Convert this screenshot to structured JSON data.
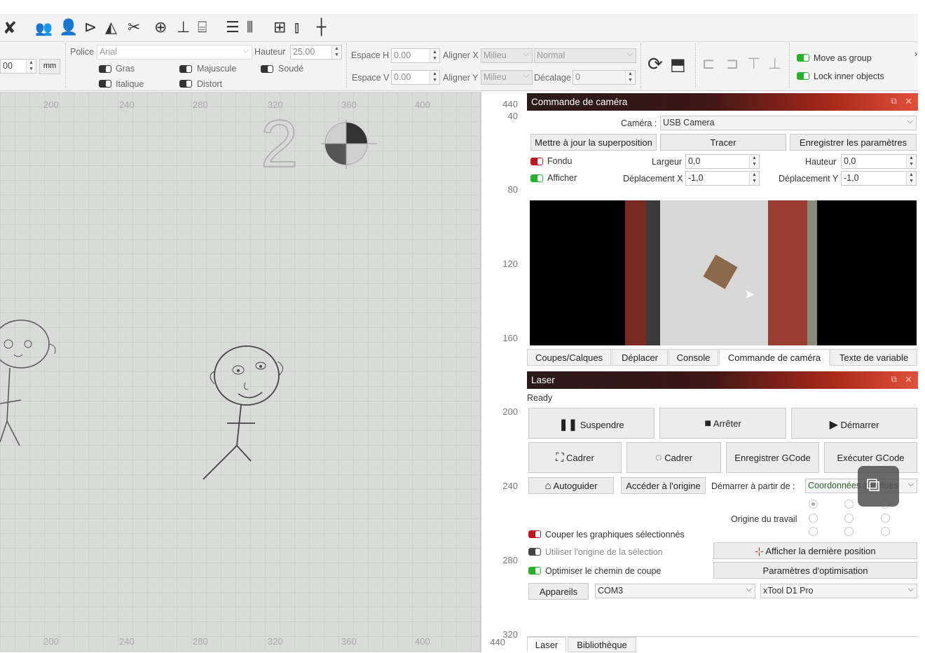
{
  "toolbar": {
    "icons": [
      "wrench-icon",
      "users-icon",
      "user-icon",
      "triangle-flag-icon",
      "mirror-icon",
      "scissors-icon",
      "target-icon",
      "align-bottom-icon",
      "align-center-icon",
      "distribute-h-icon",
      "distribute-v-icon",
      "grid-icon",
      "measure-icon"
    ]
  },
  "props": {
    "unit_value": "00",
    "unit": "mm",
    "font_label": "Police",
    "font_value": "Arial",
    "height_label": "Hauteur",
    "height_value": "25.00",
    "bold_label": "Gras",
    "upper_label": "Majuscule",
    "weld_label": "Soudé",
    "italic_label": "Italique",
    "distort_label": "Distort",
    "hspace_label": "Espace H",
    "hspace_value": "0.00",
    "vspace_label": "Espace V",
    "vspace_value": "0.00",
    "alignx_label": "Aligner X",
    "alignx_value": "Milieu",
    "aligny_label": "Aligner Y",
    "aligny_value": "Milieu",
    "style_value": "Normal",
    "offset_label": "Décalage",
    "offset_value": "0",
    "move_group_label": "Move as group",
    "lock_inner_label": "Lock inner objects",
    "more": "›"
  },
  "canvas": {
    "top_ticks": [
      "200",
      "240",
      "280",
      "320",
      "360",
      "400"
    ],
    "bottom_ticks": [
      "200",
      "240",
      "280",
      "320",
      "360",
      "400"
    ],
    "big_digit": "2"
  },
  "ruler": {
    "ticks": [
      "40",
      "80",
      "120",
      "160",
      "200",
      "240",
      "280",
      "320"
    ],
    "top": "440",
    "bottom": "440"
  },
  "camera": {
    "title": "Commande de caméra",
    "camera_label": "Caméra :",
    "camera_value": "USB Camera",
    "update_overlay": "Mettre à jour la superposition",
    "trace": "Tracer",
    "save_params": "Enregistrer les paramètres",
    "fade_label": "Fondu",
    "show_label": "Afficher",
    "width_label": "Largeur",
    "width_value": "0,0",
    "height_label": "Hauteur",
    "height_value": "0,0",
    "movex_label": "Déplacement X",
    "movex_value": "-1,0",
    "movey_label": "Déplacement Y",
    "movey_value": "-1,0"
  },
  "tabs1": [
    "Coupes/Calques",
    "Déplacer",
    "Console",
    "Commande de caméra",
    "Texte de variable"
  ],
  "laser": {
    "title": "Laser",
    "status": "Ready",
    "pause": "Suspendre",
    "stop": "Arrêter",
    "start": "Démarrer",
    "frame1": "Cadrer",
    "frame2": "Cadrer",
    "save_gcode": "Enregistrer GCode",
    "run_gcode": "Exécuter GCode",
    "home": "Autoguider",
    "goto_origin": "Accéder à l'origine",
    "start_from_label": "Démarrer à partir de :",
    "start_from_value": "Coordonnées absolues",
    "job_origin_label": "Origine du travail",
    "cut_selected": "Couper les graphiques sélectionnés",
    "use_selection_origin": "Utiliser l'origine de la sélection",
    "show_last_pos": "Afficher la dernière position",
    "optimize_path": "Optimiser le chemin de coupe",
    "optimize_params": "Paramètres d'optimisation",
    "devices": "Appareils",
    "port": "COM3",
    "machine": "xTool D1 Pro"
  },
  "tabs2": [
    "Laser",
    "Bibliothèque"
  ],
  "colors": {
    "accent_red": "#c0151c",
    "accent_green": "#27b22b"
  }
}
